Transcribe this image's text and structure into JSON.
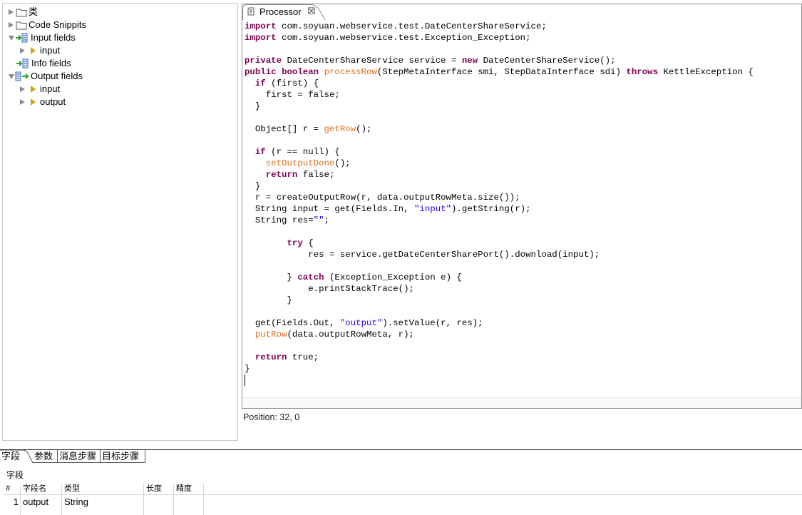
{
  "tree": {
    "items": [
      {
        "label": "类",
        "kind": "folder"
      },
      {
        "label": "Code Snippits",
        "kind": "folder"
      },
      {
        "label": "Input fields",
        "kind": "input-fields"
      },
      {
        "label": "input",
        "kind": "field"
      },
      {
        "label": "Info fields",
        "kind": "info-fields"
      },
      {
        "label": "Output fields",
        "kind": "output-fields"
      },
      {
        "label": "input",
        "kind": "field"
      },
      {
        "label": "output",
        "kind": "field"
      }
    ]
  },
  "editor": {
    "tab_label": "Processor",
    "tab_close": "☒",
    "position_text": "Position: 32, 0",
    "code_lines": [
      [
        [
          "kw",
          "import"
        ],
        [
          "t",
          " com.soyuan.webservice.test.DateCenterShareService;"
        ]
      ],
      [
        [
          "kw",
          "import"
        ],
        [
          "t",
          " com.soyuan.webservice.test.Exception_Exception;"
        ]
      ],
      [],
      [
        [
          "kw",
          "private"
        ],
        [
          "t",
          " DateCenterShareService service = "
        ],
        [
          "kw",
          "new"
        ],
        [
          "t",
          " DateCenterShareService();"
        ]
      ],
      [
        [
          "kw",
          "public"
        ],
        [
          "t",
          " "
        ],
        [
          "kw",
          "boolean"
        ],
        [
          "t",
          " "
        ],
        [
          "fn",
          "processRow"
        ],
        [
          "t",
          "(StepMetaInterface smi, StepDataInterface sdi) "
        ],
        [
          "kw",
          "throws"
        ],
        [
          "t",
          " KettleException {"
        ]
      ],
      [
        [
          "t",
          "  "
        ],
        [
          "kw",
          "if"
        ],
        [
          "t",
          " (first) {"
        ]
      ],
      [
        [
          "t",
          "    first = false;"
        ]
      ],
      [
        [
          "t",
          "  }"
        ]
      ],
      [],
      [
        [
          "t",
          "  Object[] r = "
        ],
        [
          "fn",
          "getRow"
        ],
        [
          "t",
          "();"
        ]
      ],
      [],
      [
        [
          "t",
          "  "
        ],
        [
          "kw",
          "if"
        ],
        [
          "t",
          " (r == null) {"
        ]
      ],
      [
        [
          "t",
          "    "
        ],
        [
          "fn",
          "setOutputDone"
        ],
        [
          "t",
          "();"
        ]
      ],
      [
        [
          "t",
          "    "
        ],
        [
          "kw",
          "return"
        ],
        [
          "t",
          " false;"
        ]
      ],
      [
        [
          "t",
          "  }"
        ]
      ],
      [
        [
          "t",
          "  r = createOutputRow(r, data.outputRowMeta.size());"
        ]
      ],
      [
        [
          "t",
          "  String input = get(Fields.In, "
        ],
        [
          "str",
          "\"input\""
        ],
        [
          "t",
          ").getString(r);"
        ]
      ],
      [
        [
          "t",
          "  String res="
        ],
        [
          "str",
          "\"\""
        ],
        [
          "t",
          ";"
        ]
      ],
      [],
      [
        [
          "t",
          "        "
        ],
        [
          "kw",
          "try"
        ],
        [
          "t",
          " {"
        ]
      ],
      [
        [
          "t",
          "            res = service.getDateCenterSharePort().download(input);"
        ]
      ],
      [],
      [
        [
          "t",
          "        } "
        ],
        [
          "kw",
          "catch"
        ],
        [
          "t",
          " (Exception_Exception e) {"
        ]
      ],
      [
        [
          "t",
          "            e.printStackTrace();"
        ]
      ],
      [
        [
          "t",
          "        }"
        ]
      ],
      [],
      [
        [
          "t",
          "  get(Fields.Out, "
        ],
        [
          "str",
          "\"output\""
        ],
        [
          "t",
          ").setValue(r, res);"
        ]
      ],
      [
        [
          "t",
          "  "
        ],
        [
          "fn",
          "putRow"
        ],
        [
          "t",
          "(data.outputRowMeta, r);"
        ]
      ],
      [],
      [
        [
          "t",
          "  "
        ],
        [
          "kw",
          "return"
        ],
        [
          "t",
          " true;"
        ]
      ],
      [
        [
          "t",
          "}"
        ]
      ]
    ]
  },
  "bottom": {
    "tabs": [
      "字段",
      "参数",
      "消息步骤",
      "目标步骤"
    ],
    "section_label": "字段",
    "columns": [
      "#",
      "字段名",
      "类型",
      "长度",
      "精度"
    ],
    "rows": [
      {
        "num": "1",
        "name": "output",
        "type": "String",
        "length": "",
        "precision": ""
      }
    ]
  },
  "colors": {
    "keyword": "#7f0055",
    "method": "#e07020",
    "string": "#2a00ff"
  }
}
